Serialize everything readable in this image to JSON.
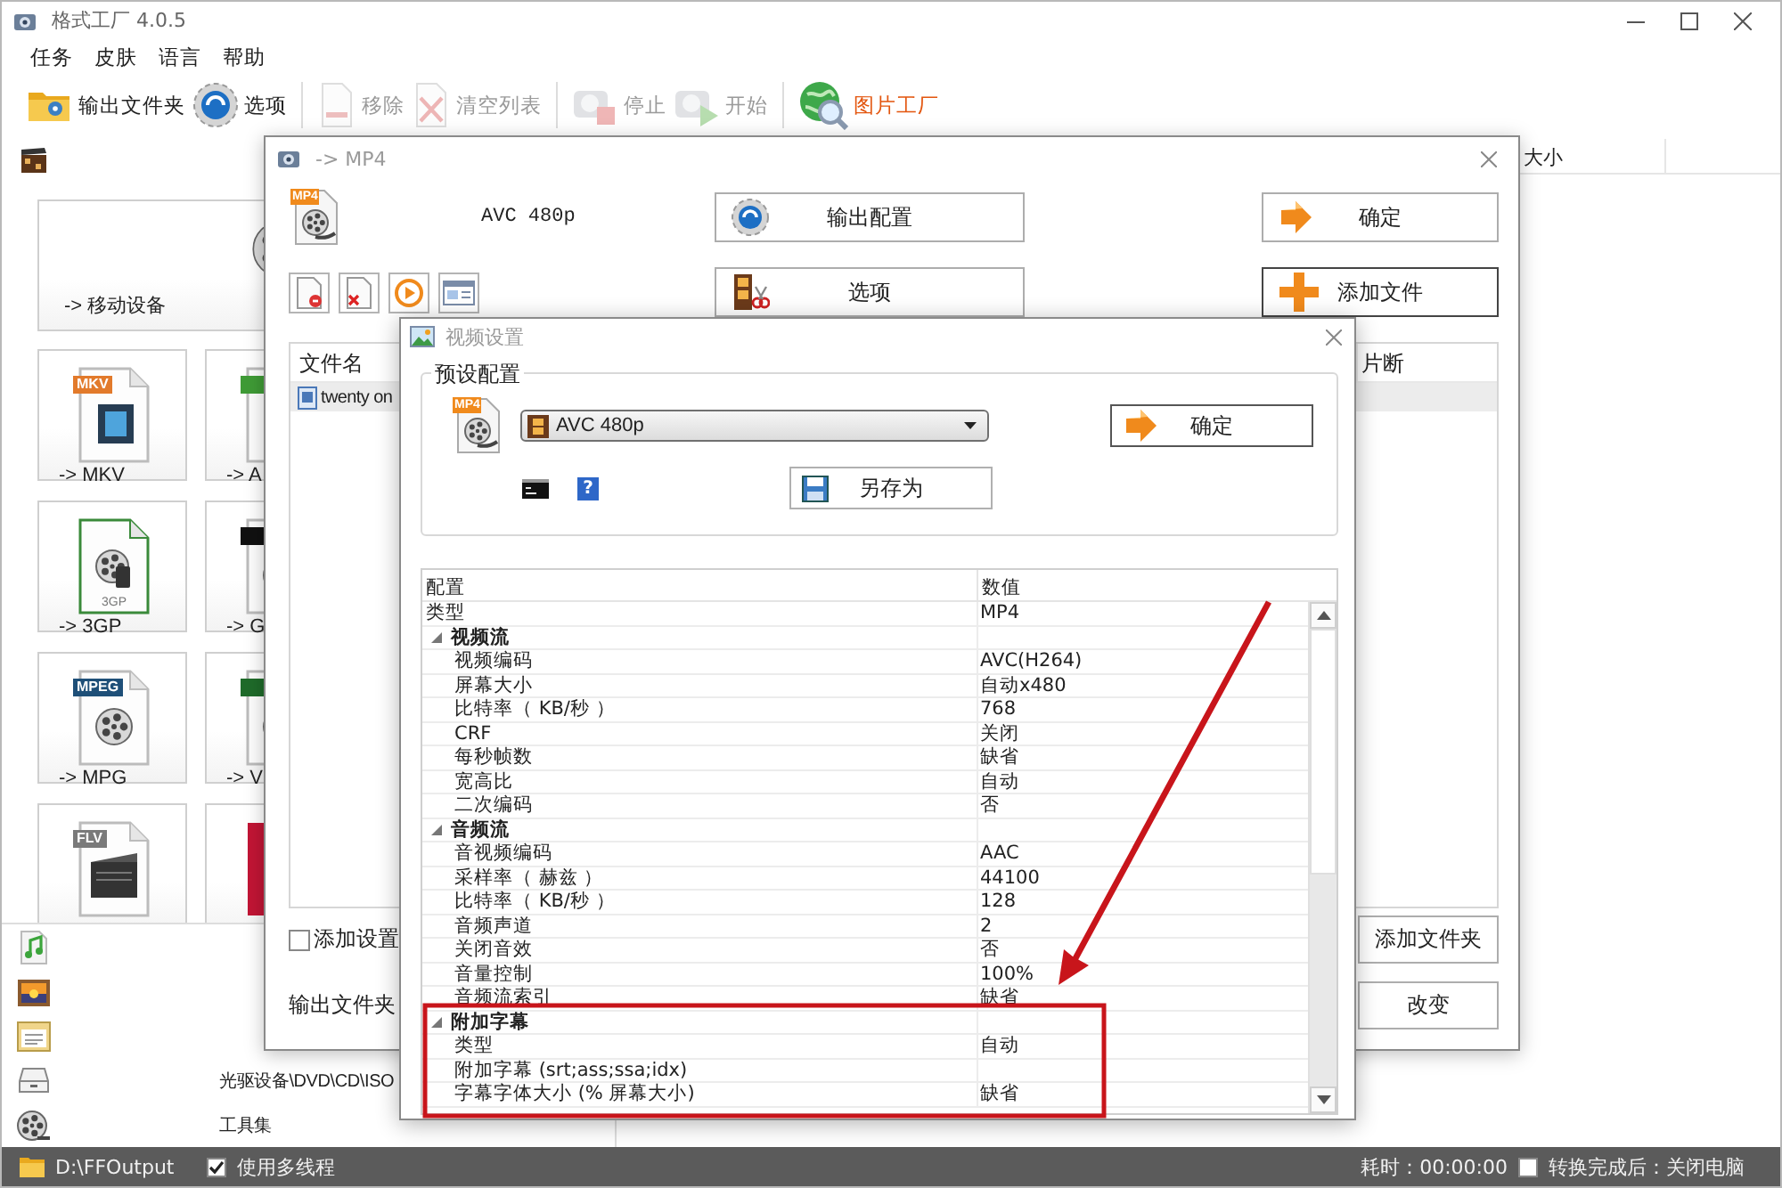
{
  "window": {
    "title": "格式工厂 4.0.5"
  },
  "menu": [
    {
      "label": "任务"
    },
    {
      "label": "皮肤"
    },
    {
      "label": "语言"
    },
    {
      "label": "帮助"
    }
  ],
  "toolbar": [
    {
      "label": "输出文件夹",
      "kind": "folder",
      "disabled": false
    },
    {
      "label": "选项",
      "kind": "options",
      "disabled": false
    },
    {
      "label": "移除",
      "kind": "remove",
      "disabled": true
    },
    {
      "label": "清空列表",
      "kind": "clear",
      "disabled": true
    },
    {
      "label": "停止",
      "kind": "stop",
      "disabled": true
    },
    {
      "label": "开始",
      "kind": "start",
      "disabled": true
    },
    {
      "label": "图片工厂",
      "kind": "picture",
      "disabled": false
    }
  ],
  "sidebar": {
    "tiles": [
      {
        "kind": "device",
        "label": "-> 移动设备"
      },
      {
        "kind": "mkv",
        "label": "-> MKV",
        "badge": "MKV"
      },
      {
        "kind": "avi",
        "label": "-> A"
      },
      {
        "kind": "threegp",
        "label": "-> 3GP",
        "badge": "3GP"
      },
      {
        "kind": "gif",
        "label": "-> G"
      },
      {
        "kind": "mpg",
        "label": "-> MPG",
        "badge": "MPEG"
      },
      {
        "kind": "vob",
        "label": "-> V"
      },
      {
        "kind": "flv",
        "badge": "FLV"
      },
      {
        "kind": "swf"
      }
    ],
    "categories": [
      {
        "kind": "music"
      },
      {
        "kind": "picture"
      },
      {
        "kind": "document"
      },
      {
        "kind": "disc",
        "label": "光驱设备\\DVD\\CD\\ISO"
      },
      {
        "kind": "tools",
        "label": "工具集"
      }
    ]
  },
  "task_list": {
    "columns": [
      {
        "label": "大小"
      }
    ]
  },
  "convert_dialog": {
    "title": "-> MP4",
    "format_badge": "MP4",
    "preset": "AVC 480p",
    "buttons": [
      {
        "label": "输出配置",
        "kind": "config"
      },
      {
        "label": "确定",
        "kind": "ok"
      },
      {
        "label": "选项",
        "kind": "options"
      },
      {
        "label": "添加文件",
        "kind": "add"
      }
    ],
    "files": {
      "columns": [
        "文件名",
        "片断"
      ],
      "rows": [
        {
          "name": "twenty on",
          "selected": true
        }
      ]
    },
    "add_setting_name": {
      "label": "添加设置",
      "checked": false
    },
    "bottom_buttons": [
      {
        "label": "添加文件夹"
      },
      {
        "label": "改变"
      }
    ],
    "output_folder_label": "输出文件夹"
  },
  "video_dialog": {
    "title": "视频设置",
    "preset_group": {
      "title": "预设配置",
      "format_badge": "MP4",
      "preset": "AVC 480p",
      "ok": "确定",
      "help": "?",
      "save_as": "另存为"
    },
    "grid": {
      "columns": [
        "配置",
        "数值"
      ],
      "rows": [
        {
          "kind": "prop",
          "name": "类型",
          "value": "MP4"
        },
        {
          "kind": "group",
          "name": "视频流",
          "expanded": true,
          "children": [
            {
              "name": "视频编码",
              "value": "AVC(H264)"
            },
            {
              "name": "屏幕大小",
              "value": "自动x480"
            },
            {
              "name": "比特率（ KB/秒 ）",
              "value": "768"
            },
            {
              "name": "CRF",
              "value": "关闭"
            },
            {
              "name": "每秒帧数",
              "value": "缺省"
            },
            {
              "name": "宽高比",
              "value": "自动"
            },
            {
              "name": "二次编码",
              "value": "否"
            }
          ]
        },
        {
          "kind": "group",
          "name": "音频流",
          "expanded": true,
          "children": [
            {
              "name": "音视频编码",
              "value": "AAC"
            },
            {
              "name": "采样率（ 赫兹 ）",
              "value": "44100"
            },
            {
              "name": "比特率（ KB/秒 ）",
              "value": "128"
            },
            {
              "name": "音频声道",
              "value": "2"
            },
            {
              "name": "关闭音效",
              "value": "否"
            },
            {
              "name": "音量控制",
              "value": "100%"
            },
            {
              "name": "音频流索引",
              "value": "缺省"
            }
          ]
        },
        {
          "kind": "group",
          "name": "附加字幕",
          "expanded": true,
          "children": [
            {
              "name": "类型",
              "value": "自动"
            },
            {
              "name": "附加字幕 (srt;ass;ssa;idx)"
            },
            {
              "name": "字幕字体大小 (% 屏幕大小)",
              "value": "缺省"
            }
          ]
        }
      ]
    }
  },
  "status_bar": {
    "path": "D:\\FFOutput",
    "multithread": {
      "label": "使用多线程",
      "checked": true
    },
    "elapsed": "耗时：00:00:00",
    "shutdown": {
      "label": "转换完成后：关闭电脑",
      "checked": false
    }
  }
}
